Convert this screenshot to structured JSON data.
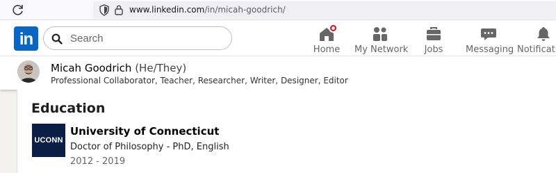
{
  "browser": {
    "url_host": "www.linkedin.com",
    "url_path": "/in/micah-goodrich/"
  },
  "nav": {
    "logo_text": "in",
    "search_placeholder": "Search",
    "items": [
      {
        "label": "Home",
        "icon": "home-icon",
        "has_badge": true
      },
      {
        "label": "My Network",
        "icon": "network-icon"
      },
      {
        "label": "Jobs",
        "icon": "briefcase-icon"
      },
      {
        "label": "Messaging",
        "icon": "messaging-icon"
      },
      {
        "label": "Notifications",
        "icon": "bell-icon"
      }
    ]
  },
  "profile": {
    "name": "Micah Goodrich",
    "pronouns": "(He/They)",
    "headline": "Professional Collaborator, Teacher, Researcher, Writer, Designer, Editor"
  },
  "education": {
    "section_title": "Education",
    "entries": [
      {
        "logo_text": "UCONN",
        "school": "University of Connecticut",
        "degree": "Doctor of Philosophy - PhD, English",
        "years": "2012 - 2019"
      }
    ]
  },
  "colors": {
    "linkedin_blue": "#0a66c2",
    "badge_red": "#cc1016",
    "uconn_navy": "#0b1e45"
  }
}
